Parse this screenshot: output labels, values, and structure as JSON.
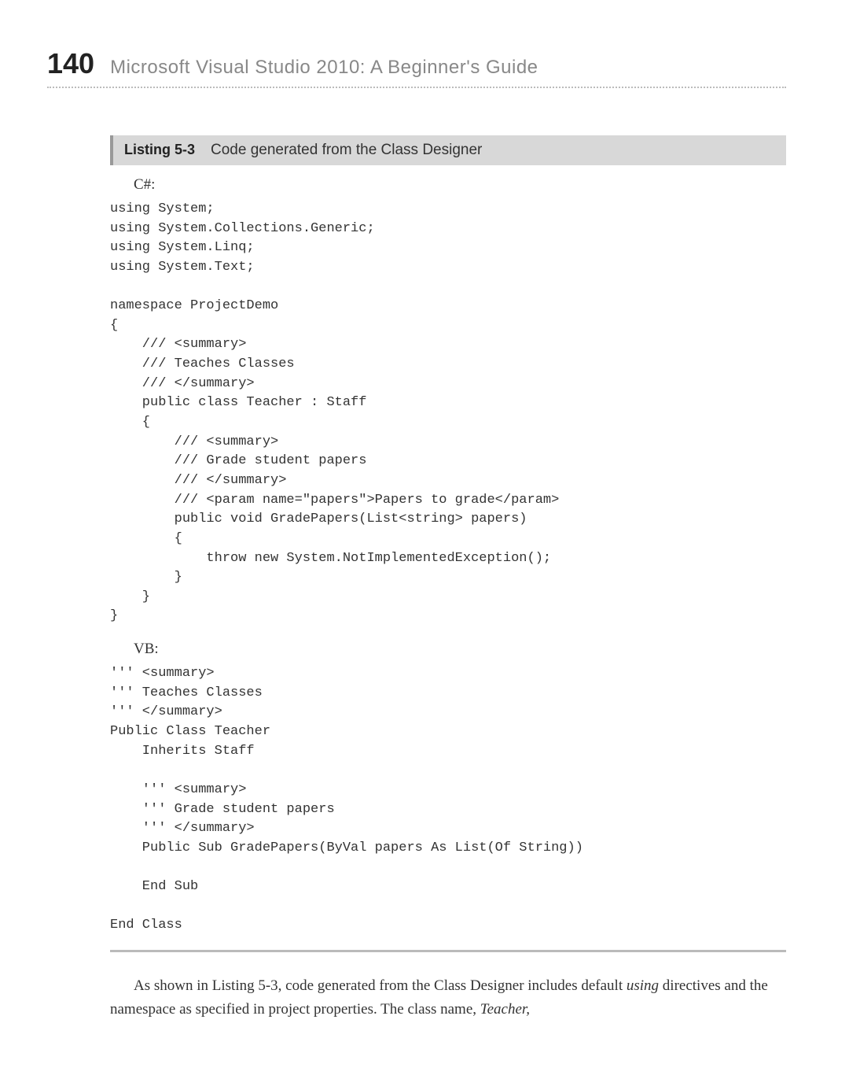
{
  "header": {
    "page_number": "140",
    "book_title": "Microsoft Visual Studio 2010: A Beginner's Guide"
  },
  "listing": {
    "label": "Listing 5-3",
    "title": "Code generated from the Class Designer"
  },
  "csharp": {
    "label": "C#:",
    "code": "using System;\nusing System.Collections.Generic;\nusing System.Linq;\nusing System.Text;\n\nnamespace ProjectDemo\n{\n    /// <summary>\n    /// Teaches Classes\n    /// </summary>\n    public class Teacher : Staff\n    {\n        /// <summary>\n        /// Grade student papers\n        /// </summary>\n        /// <param name=\"papers\">Papers to grade</param>\n        public void GradePapers(List<string> papers)\n        {\n            throw new System.NotImplementedException();\n        }\n    }\n}"
  },
  "vb": {
    "label": "VB:",
    "code": "''' <summary>\n''' Teaches Classes\n''' </summary>\nPublic Class Teacher\n    Inherits Staff\n\n    ''' <summary>\n    ''' Grade student papers\n    ''' </summary>\n    Public Sub GradePapers(ByVal papers As List(Of String))\n\n    End Sub\n\nEnd Class"
  },
  "body": {
    "text_before_using": "As shown in Listing 5-3, code generated from the Class Designer includes default ",
    "using_word": "using",
    "text_mid": " directives and the namespace as specified in project properties. The class name, ",
    "teacher_word": "Teacher,"
  }
}
